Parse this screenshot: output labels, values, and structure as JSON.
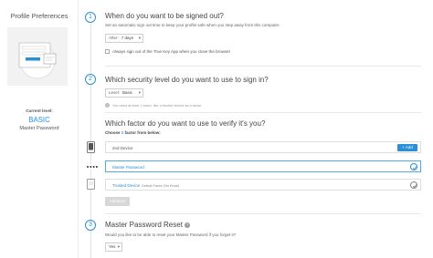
{
  "sidebar": {
    "title": "Profile Preferences",
    "current_level_label": "Current level:",
    "current_level_value": "BASIC",
    "current_method": "Master Password"
  },
  "sections": {
    "signout": {
      "number": "1",
      "heading": "When do you want to be signed out?",
      "description": "Set an automatic sign out time to keep your profile safe when you step away from this computer.",
      "select_label": "After:",
      "select_value": "7 days",
      "checkbox_label": "Always sign out of the True Key App when you close the browser"
    },
    "security": {
      "number": "2",
      "heading": "Which security level do you want to use to sign in?",
      "select_label": "Level:",
      "select_value": "Basic",
      "note": "You need at least 1 factor, like a trusted device as a factor."
    },
    "factors": {
      "heading": "Which factor do you want to use to verify it's you?",
      "choose_prefix": "Choose ",
      "choose_count": "1",
      "choose_suffix": " factor from below:",
      "items": [
        {
          "label": "2nd Device",
          "icon": "phone-icon",
          "action": "+ Add"
        },
        {
          "label": "Master Password",
          "icon": "password-dots-icon",
          "selected": true
        },
        {
          "label": "Trusted Device",
          "detail": "Default Factor (Via Email)",
          "icon": "laptop-icon"
        }
      ],
      "advance_label": "Advance"
    },
    "reset": {
      "number": "3",
      "heading": "Master Password Reset",
      "description": "Would you like to be able to reset your Master Password if you forget it?",
      "select_value": "Yes"
    }
  },
  "colors": {
    "accent": "#2a8fd6",
    "selected_border": "#53a9e3",
    "disabled_button": "#d7d7d7"
  }
}
